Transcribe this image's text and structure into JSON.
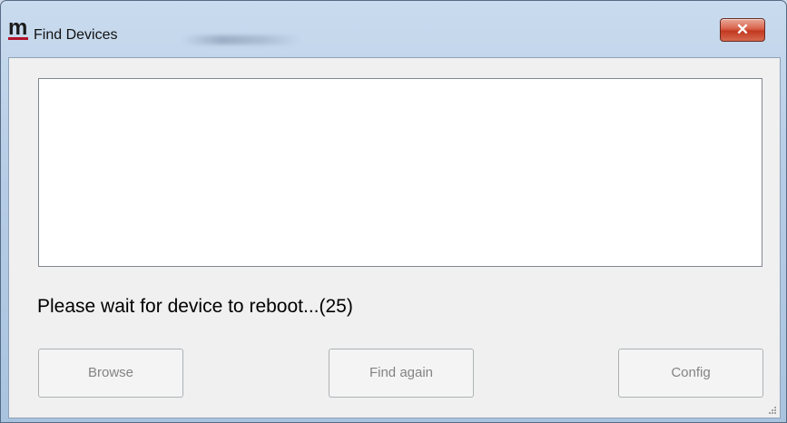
{
  "window": {
    "title": "Find Devices",
    "logo_letter": "m",
    "close_glyph": "✕"
  },
  "status_text": "Please wait for device to reboot...(25)",
  "buttons": {
    "browse": "Browse",
    "find_again": "Find again",
    "config": "Config"
  },
  "colors": {
    "logo_accent": "#b3122a",
    "close_button": "#c2391f"
  }
}
